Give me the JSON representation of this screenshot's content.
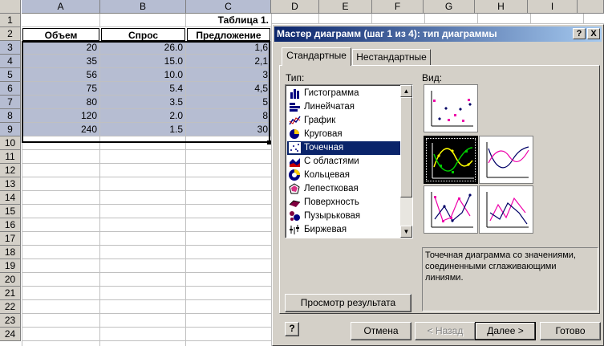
{
  "spreadsheet": {
    "column_headers": [
      "A",
      "B",
      "C",
      "D",
      "E",
      "F",
      "G",
      "H",
      "I"
    ],
    "row_headers": [
      "1",
      "2",
      "3",
      "4",
      "5",
      "6",
      "7",
      "8",
      "9",
      "10",
      "11",
      "12",
      "13",
      "14",
      "15",
      "16",
      "17",
      "18",
      "19",
      "20",
      "21",
      "22",
      "23",
      "24"
    ],
    "table_title": "Таблица 1.",
    "headers": [
      "Объем",
      "Спрос",
      "Предложение"
    ],
    "rows": [
      [
        "20",
        "26.0",
        "1,6"
      ],
      [
        "35",
        "15.0",
        "2,1"
      ],
      [
        "56",
        "10.0",
        "3"
      ],
      [
        "75",
        "5.4",
        "4,5"
      ],
      [
        "80",
        "3.5",
        "5"
      ],
      [
        "120",
        "2.0",
        "8"
      ],
      [
        "240",
        "1.5",
        "30"
      ]
    ]
  },
  "dialog": {
    "title": "Мастер диаграмм (шаг 1 из 4): тип диаграммы",
    "help_title_button": "?",
    "close_title_button": "X",
    "tabs": [
      "Стандартные",
      "Нестандартные"
    ],
    "type_label": "Тип:",
    "view_label": "Вид:",
    "chart_types": [
      {
        "label": "Гистограмма",
        "icon": "column-chart-icon"
      },
      {
        "label": "Линейчатая",
        "icon": "bar-chart-icon"
      },
      {
        "label": "График",
        "icon": "line-chart-icon"
      },
      {
        "label": "Круговая",
        "icon": "pie-chart-icon"
      },
      {
        "label": "Точечная",
        "icon": "scatter-chart-icon"
      },
      {
        "label": "С областями",
        "icon": "area-chart-icon"
      },
      {
        "label": "Кольцевая",
        "icon": "doughnut-chart-icon"
      },
      {
        "label": "Лепестковая",
        "icon": "radar-chart-icon"
      },
      {
        "label": "Поверхность",
        "icon": "surface-chart-icon"
      },
      {
        "label": "Пузырьковая",
        "icon": "bubble-chart-icon"
      },
      {
        "label": "Биржевая",
        "icon": "stock-chart-icon"
      }
    ],
    "selected_type": "Точечная",
    "description": "Точечная диаграмма со значениями, соединенными сглаживающими линиями.",
    "buttons": {
      "preview": "Просмотр результата",
      "help": "?",
      "cancel": "Отмена",
      "back": "< Назад",
      "next": "Далее >",
      "finish": "Готово"
    }
  },
  "colors": {
    "selection": "#b6bdd2",
    "dialog_face": "#d4d0c8",
    "titlebar_start": "#0a246a",
    "titlebar_end": "#a6caf0"
  }
}
